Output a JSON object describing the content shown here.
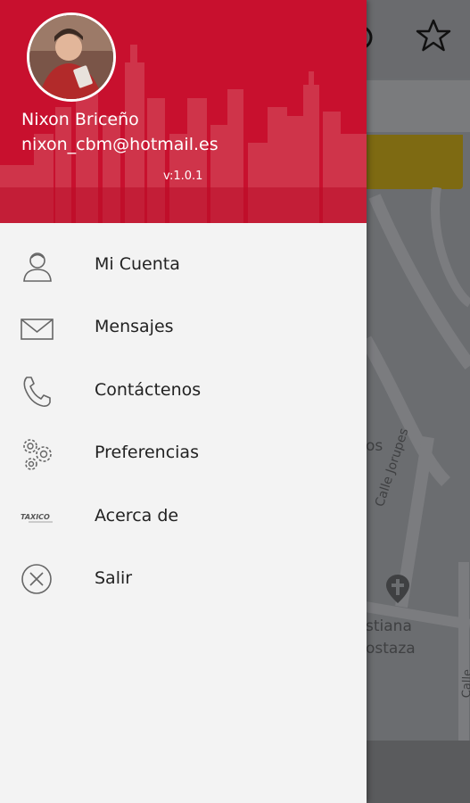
{
  "user": {
    "name": "Nixon Briceño",
    "email": "nixon_cbm@hotmail.es"
  },
  "app": {
    "version": "v:1.0.1"
  },
  "menu": {
    "items": [
      {
        "label": "Mi Cuenta",
        "icon": "user-icon"
      },
      {
        "label": "Mensajes",
        "icon": "envelope-icon"
      },
      {
        "label": "Contáctenos",
        "icon": "phone-icon"
      },
      {
        "label": "Preferencias",
        "icon": "gears-icon"
      },
      {
        "label": "Acerca de",
        "icon": "taxico-logo-icon",
        "icon_text": "TAXICO"
      },
      {
        "label": "Salir",
        "icon": "close-circle-icon"
      }
    ]
  },
  "map": {
    "labels": [
      "os",
      "Calle Jorupes",
      "stiana",
      "ostaza",
      "Calle Buganvillas"
    ]
  },
  "colors": {
    "header_red": "#c8102e",
    "drawer_bg": "#f3f3f3",
    "icon_gray": "#666666"
  }
}
